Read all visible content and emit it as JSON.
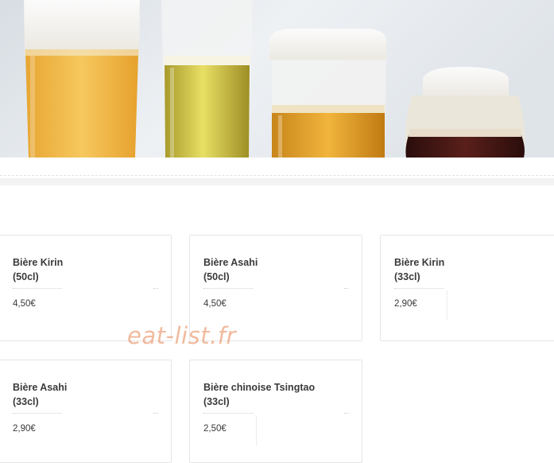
{
  "menu": {
    "items": [
      {
        "name": "Bière Kirin\n(50cl)",
        "price": "4,50€"
      },
      {
        "name": "Bière Asahi\n(50cl)",
        "price": "4,50€"
      },
      {
        "name": "Bière Kirin\n(33cl)",
        "price": "2,90€"
      },
      {
        "name": "Bière Asahi\n(33cl)",
        "price": "2,90€"
      },
      {
        "name": "Bière chinoise Tsingtao\n(33cl)",
        "price": "2,50€"
      }
    ]
  },
  "watermark": {
    "text": "eat-list.fr"
  },
  "hero": {
    "image": "beer-glasses-photo"
  },
  "colors": {
    "watermark": "#eca078",
    "border": "#e6e6e6",
    "text": "#3a3a3a"
  }
}
